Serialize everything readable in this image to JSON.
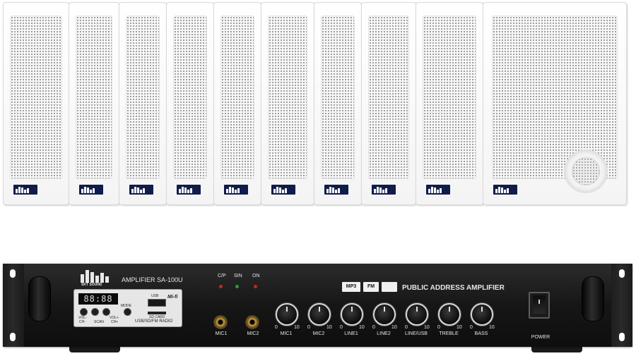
{
  "speakers": {
    "count": 10,
    "brand_badge_icon": "skt-sound-logo-icon",
    "color": "#ffffff"
  },
  "amplifier": {
    "brand": "SKT SOUND",
    "model": "AMPLIFIER SA-100U",
    "title": "PUBLIC ADDRESS AMPLIFIER",
    "indicators": [
      "C/P",
      "SIN",
      "ON"
    ],
    "mp3_module": {
      "display": "88:88",
      "usb_label": "USB",
      "hifi_label": "Mi-fi",
      "mode_label": "MODE",
      "sd_label": "SD CARD",
      "radio_label": "USB/SD/FM RADIO",
      "vol_minus": "VOL-",
      "vol_plus": "VOL+",
      "ch_minus": "CH-",
      "ch_plus": "CH+",
      "scan": "SCAN"
    },
    "badges": {
      "mp3": "MP3",
      "fm": "FM"
    },
    "mic_jacks": [
      "MIC1",
      "MIC2"
    ],
    "knobs": [
      "MIC1",
      "MIC2",
      "LINE1",
      "LINE2",
      "LINE/USB",
      "TREBLE",
      "BASS"
    ],
    "scale_min": "0",
    "scale_max": "10",
    "power_label": "POWER",
    "colors": {
      "panel": "#161616",
      "text": "#e6e6e6",
      "led_red": "#c0281e",
      "led_green": "#2e9a2e"
    }
  }
}
